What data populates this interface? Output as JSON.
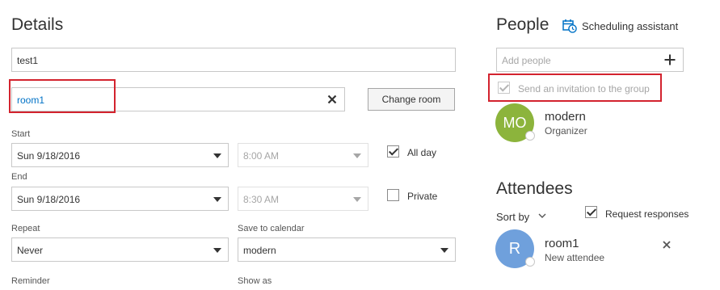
{
  "details": {
    "heading": "Details",
    "title_value": "test1",
    "location_value": "room1",
    "change_room_label": "Change room",
    "start_label": "Start",
    "start_date": "Sun 9/18/2016",
    "start_time": "8:00 AM",
    "end_label": "End",
    "end_date": "Sun 9/18/2016",
    "end_time": "8:30 AM",
    "all_day_label": "All day",
    "all_day_checked": true,
    "private_label": "Private",
    "private_checked": false,
    "repeat_label": "Repeat",
    "repeat_value": "Never",
    "save_to_calendar_label": "Save to calendar",
    "save_to_calendar_value": "modern",
    "reminder_label": "Reminder",
    "show_as_label": "Show as"
  },
  "people": {
    "heading": "People",
    "scheduling_assistant_label": "Scheduling assistant",
    "add_people_placeholder": "Add people",
    "invite_group_label": "Send an invitation to the group",
    "organizer": {
      "initials": "MO",
      "name": "modern",
      "role": "Organizer",
      "color": "#8cb43c"
    }
  },
  "attendees": {
    "heading": "Attendees",
    "sort_by_label": "Sort by",
    "request_responses_label": "Request responses",
    "request_responses_checked": true,
    "list": [
      {
        "initials": "R",
        "name": "room1",
        "role": "New attendee",
        "color": "#6fa0dc"
      }
    ]
  },
  "icons": {
    "clear": "close-icon",
    "add": "plus-icon",
    "calendar": "calendar-clock-icon",
    "sort": "chevron-down-icon",
    "remove": "close-icon"
  },
  "colors": {
    "accent": "#0072c6",
    "highlight_box": "#d3232e"
  }
}
